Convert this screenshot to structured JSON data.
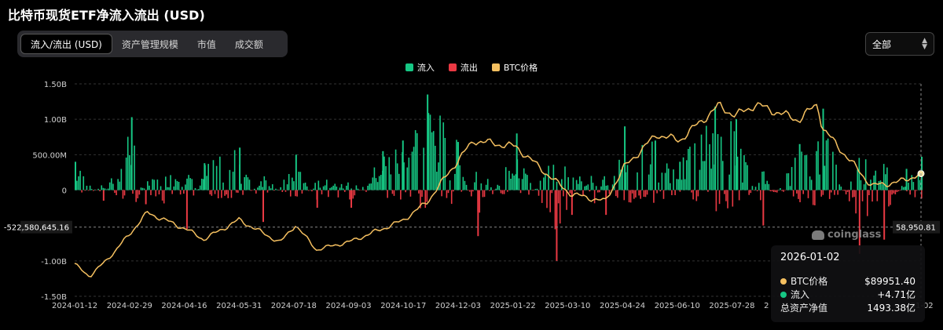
{
  "title": "比特币现货ETF净流入流出 (USD)",
  "tabs": [
    {
      "label": "流入/流出 (USD)",
      "active": true
    },
    {
      "label": "资产管理规模",
      "active": false
    },
    {
      "label": "市值",
      "active": false
    },
    {
      "label": "成交额",
      "active": false
    }
  ],
  "range_select": {
    "value": "全部"
  },
  "legend": [
    {
      "label": "流入",
      "color": "#16c784"
    },
    {
      "label": "流出",
      "color": "#ea3943"
    },
    {
      "label": "BTC价格",
      "color": "#f5c060"
    }
  ],
  "watermark": "coinglass",
  "tooltip": {
    "date": "2026-01-02",
    "rows": [
      {
        "label": "BTC价格",
        "value": "$89951.40",
        "color": "#f5c060"
      },
      {
        "label": "流入",
        "value": "+4.71亿",
        "color": "#16c784"
      },
      {
        "label": "总资产净值",
        "value": "1493.38亿",
        "color": ""
      }
    ]
  },
  "chart_data": {
    "type": "bar",
    "ylim": [
      -1500000000,
      1500000000
    ],
    "y_ticks": [
      {
        "value": 1500000000,
        "label": "1.50B"
      },
      {
        "value": 1000000000,
        "label": "1.00B"
      },
      {
        "value": 500000000,
        "label": "500.00M"
      },
      {
        "value": 0,
        "label": "0"
      },
      {
        "value": -1000000000,
        "label": "-1.00B"
      },
      {
        "value": -1500000000,
        "label": "-1.50B"
      }
    ],
    "x_range": [
      "2024-01-12",
      "2026-01-02"
    ],
    "x_ticks": [
      "2024-01-12",
      "2024-02-29",
      "2024-04-16",
      "2024-05-31",
      "2024-07-18",
      "2024-09-03",
      "2024-10-17",
      "2024-12-03",
      "2025-01-22",
      "2025-03-10",
      "2025-04-24",
      "2025-06-10",
      "2025-07-28",
      "2",
      "-01-02"
    ],
    "crosshair": {
      "y_value": -522580645.16,
      "y_label": "-522,580,645.16",
      "price_label": "58,950.81"
    },
    "flows_series": {
      "name": "流入/流出",
      "dates": [
        "2024-01-12",
        "2024-02-05",
        "2024-02-29",
        "2024-03-12",
        "2024-04-16",
        "2024-05-01",
        "2024-05-31",
        "2024-06-20",
        "2024-07-18",
        "2024-08-05",
        "2024-09-03",
        "2024-09-30",
        "2024-10-17",
        "2024-11-07",
        "2024-12-03",
        "2024-12-20",
        "2025-01-22",
        "2025-02-25",
        "2025-03-10",
        "2025-04-08",
        "2025-04-24",
        "2025-05-20",
        "2025-06-10",
        "2025-07-10",
        "2025-07-28",
        "2025-08-20",
        "2025-09-20",
        "2025-10-10",
        "2025-11-10",
        "2025-12-01",
        "2025-12-20",
        "2026-01-02"
      ],
      "values": [
        400000000,
        -150000000,
        1030000000,
        -200000000,
        -550000000,
        380000000,
        600000000,
        -450000000,
        500000000,
        -250000000,
        -250000000,
        550000000,
        700000000,
        1350000000,
        680000000,
        -650000000,
        800000000,
        -1000000000,
        -350000000,
        -350000000,
        900000000,
        700000000,
        400000000,
        1180000000,
        1000000000,
        -500000000,
        650000000,
        1150000000,
        -900000000,
        -700000000,
        300000000,
        471000000
      ]
    },
    "price_series": {
      "name": "BTC价格",
      "dates": [
        "2024-01-12",
        "2024-01-25",
        "2024-02-15",
        "2024-03-14",
        "2024-04-16",
        "2024-05-01",
        "2024-05-31",
        "2024-07-05",
        "2024-07-18",
        "2024-08-05",
        "2024-09-03",
        "2024-10-17",
        "2024-11-07",
        "2024-12-03",
        "2024-12-17",
        "2025-01-22",
        "2025-02-25",
        "2025-03-10",
        "2025-04-08",
        "2025-04-24",
        "2025-05-22",
        "2025-06-10",
        "2025-07-14",
        "2025-07-28",
        "2025-08-14",
        "2025-09-20",
        "2025-10-06",
        "2025-10-10",
        "2025-11-21",
        "2025-12-15",
        "2026-01-02"
      ],
      "values": [
        46000,
        40000,
        52000,
        71000,
        63000,
        58000,
        67500,
        56500,
        65000,
        53000,
        57000,
        67000,
        76000,
        96000,
        106000,
        103000,
        86000,
        80000,
        76500,
        93000,
        109000,
        106000,
        123000,
        118000,
        123500,
        116000,
        124000,
        112000,
        84000,
        86000,
        89951.4
      ]
    }
  }
}
